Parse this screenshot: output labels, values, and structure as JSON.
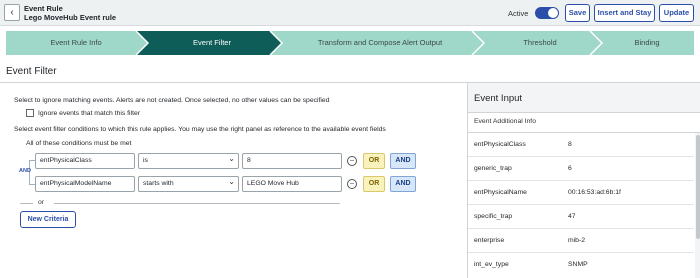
{
  "header": {
    "title_line1": "Event Rule",
    "title_line2": "Lego MoveHub Event rule",
    "active_label": "Active",
    "buttons": {
      "save": "Save",
      "insert_and_stay": "Insert and Stay",
      "update": "Update"
    }
  },
  "stepper": {
    "steps": [
      "Event Rule Info",
      "Event Filter",
      "Transform and Compose Alert Output",
      "Threshold",
      "Binding"
    ],
    "active_index": 1,
    "colors": {
      "inactive": "#9fd8c8",
      "active": "#0e5d58"
    }
  },
  "section_title": "Event Filter",
  "filter": {
    "intro_text": "Select to ignore matching events. Alerts are not created. Once selected, no other values can be specified",
    "ignore_label": "Ignore events that match this filter",
    "instructions": "Select event filter conditions to which this rule applies. You may use the right panel as reference to the available event fields",
    "all_label": "All of these conditions must be met",
    "and_connector": "AND",
    "conditions": [
      {
        "field": "entPhysicalClass",
        "operator": "is",
        "value": "8"
      },
      {
        "field": "entPhysicalModelName",
        "operator": "starts with",
        "value": "LEGO Move Hub"
      }
    ],
    "or_button": "OR",
    "and_button": "AND",
    "or_separator": "or",
    "new_criteria_label": "New Criteria"
  },
  "event_input": {
    "title": "Event Input",
    "subtitle": "Event Additional Info",
    "rows": [
      {
        "key": "entPhysicalClass",
        "value": "8"
      },
      {
        "key": "generic_trap",
        "value": "6"
      },
      {
        "key": "entPhysicalName",
        "value": "00:16:53:ad:6b:1f"
      },
      {
        "key": "specific_trap",
        "value": "47"
      },
      {
        "key": "enterprise",
        "value": "mib-2"
      },
      {
        "key": "int_ev_type",
        "value": "SNMP"
      }
    ]
  }
}
